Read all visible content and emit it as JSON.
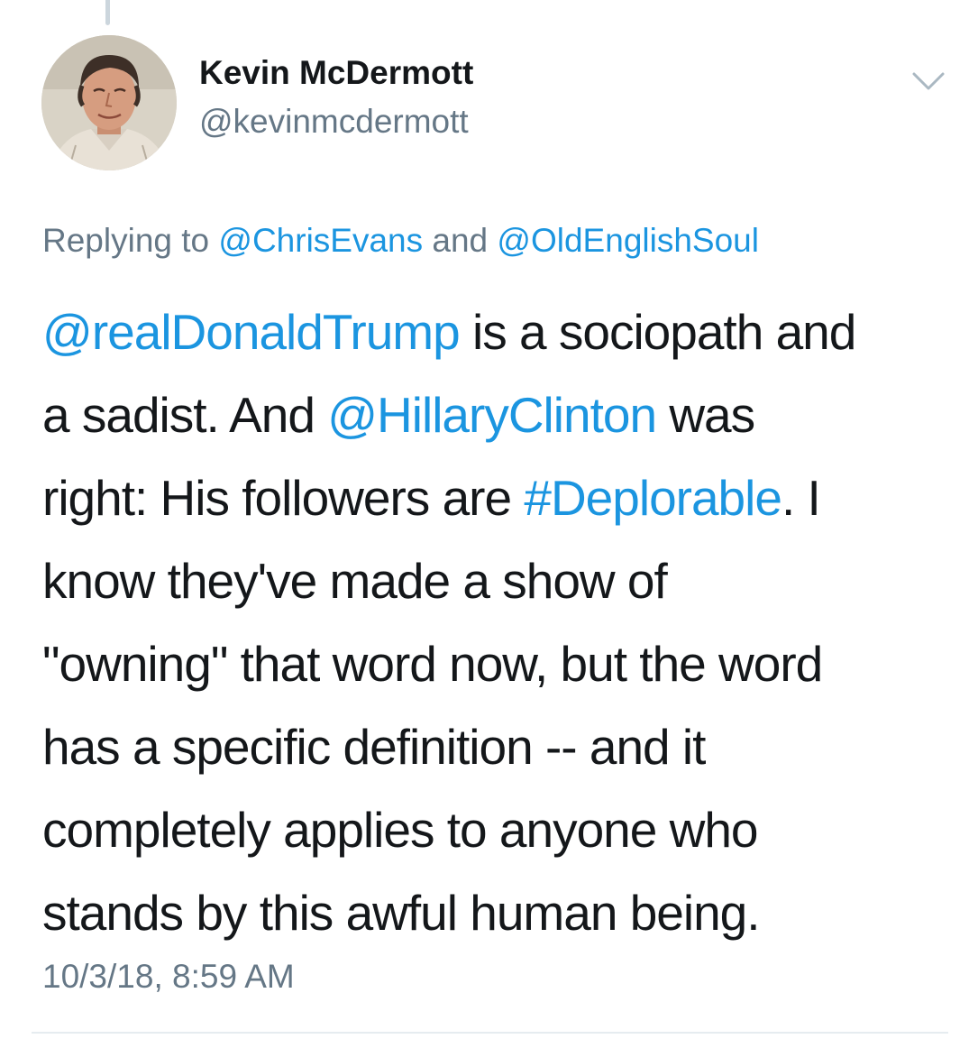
{
  "tweet": {
    "author": {
      "display_name": "Kevin McDermott",
      "handle": "@kevinmcdermott",
      "avatar_icon": "avatar-photo"
    },
    "menu_icon": "chevron-down-icon",
    "reply": {
      "prefix": "Replying to ",
      "mention_1": "@ChrisEvans",
      "conjunction": " and ",
      "mention_2": "@OldEnglishSoul"
    },
    "body": {
      "mention_trump": "@realDonaldTrump",
      "text_1": " is a sociopath and",
      "text_2": "a sadist. And ",
      "mention_clinton": "@HillaryClinton",
      "text_3": " was",
      "text_4": "right: His followers are ",
      "hashtag": "#Deplorable",
      "text_5": ". I",
      "text_6": "know they've made a show of",
      "text_7": "\"owning\" that word now, but the word",
      "text_8": "has a specific definition -- and it",
      "text_9": "completely applies to anyone who",
      "text_10": "stands by this awful human being."
    },
    "timestamp": "10/3/18, 8:59 AM"
  },
  "colors": {
    "link": "#1b95e0",
    "secondary_text": "#657786",
    "primary_text": "#14171a",
    "divider": "#e6ecf0"
  }
}
